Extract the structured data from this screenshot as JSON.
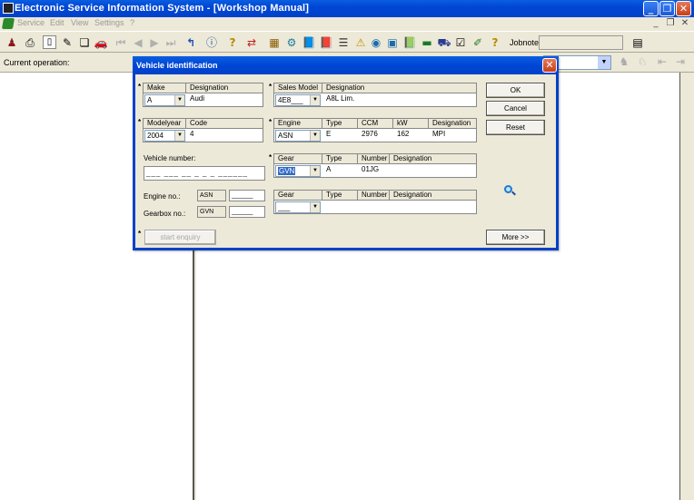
{
  "window": {
    "title": "Electronic Service Information System - [Workshop Manual]"
  },
  "menu": {
    "items": [
      "Service",
      "Edit",
      "View",
      "Settings",
      "?"
    ]
  },
  "toolbar": {
    "jobnote_label": "Jobnote:",
    "jobnote_value": ""
  },
  "operation": {
    "label": "Current operation:",
    "value": ""
  },
  "dialog": {
    "title": "Vehicle identification",
    "make": {
      "header": "Make",
      "value": "A",
      "designation_header": "Designation",
      "designation": "Audi"
    },
    "sales_model": {
      "header": "Sales Model",
      "value": "4E8___",
      "designation_header": "Designation",
      "designation": "A8L Lim."
    },
    "modelyear": {
      "header": "Modelyear",
      "value": "2004",
      "code_header": "Code",
      "code": "4"
    },
    "engine": {
      "header": "Engine",
      "value": "ASN",
      "type_header": "Type",
      "type": "E",
      "ccm_header": "CCM",
      "ccm": "2976",
      "kw_header": "kW",
      "kw": "162",
      "designation_header": "Designation",
      "designation": "MPI"
    },
    "vehicle_number": {
      "label": "Vehicle number:",
      "value": "___ ___ __ _ _ _ ______"
    },
    "gear1": {
      "header": "Gear",
      "value": "GVN",
      "type_header": "Type",
      "type": "A",
      "number_header": "Number",
      "number": "01JG",
      "designation_header": "Designation",
      "designation": ""
    },
    "engine_no": {
      "label": "Engine no.:",
      "code": "ASN",
      "value": "______"
    },
    "gearbox_no": {
      "label": "Gearbox no.:",
      "code": "GVN",
      "value": "______"
    },
    "gear2": {
      "header": "Gear",
      "value": "___",
      "type_header": "Type",
      "number_header": "Number",
      "designation_header": "Designation"
    },
    "buttons": {
      "ok": "OK",
      "cancel": "Cancel",
      "reset": "Reset",
      "start_enquiry": "start enquiry",
      "more": "More >>"
    }
  }
}
